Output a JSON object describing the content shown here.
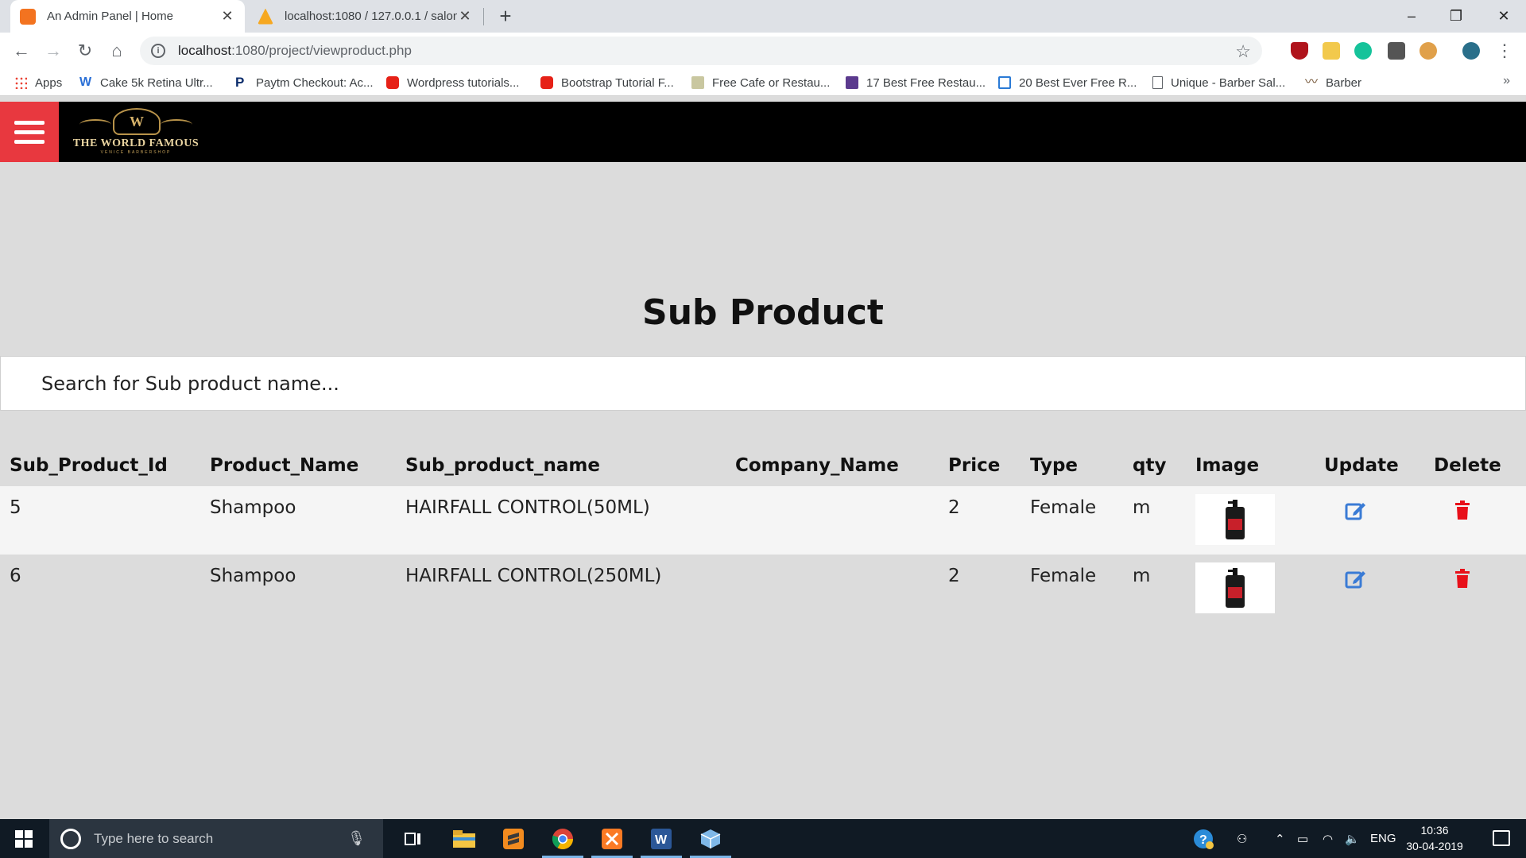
{
  "browser": {
    "tabs": [
      {
        "title": "An Admin Panel | Home",
        "active": true
      },
      {
        "title": "localhost:1080 / 127.0.0.1 / salon",
        "active": false
      }
    ],
    "address": {
      "host": "localhost",
      "path": ":1080/project/viewproduct.php"
    },
    "bookmarks": [
      "Apps",
      "Cake 5k Retina Ultr...",
      "Paytm Checkout: Ac...",
      "Wordpress tutorials...",
      "Bootstrap Tutorial F...",
      "Free Cafe or Restau...",
      "17 Best Free Restau...",
      "20 Best Ever Free R...",
      "Unique - Barber Sal...",
      "Barber"
    ],
    "bookmarks_more": "»"
  },
  "header": {
    "logo_brand": "THE WORLD FAMOUS",
    "logo_sub": "VENICE BARBERSHOP",
    "logo_monogram": "W",
    "colors": {
      "hamburger_bg": "#e8383f",
      "header_bg": "#000000",
      "gold": "#c5a25a"
    }
  },
  "main": {
    "title": "Sub Product",
    "search_placeholder": "Search for Sub product name...",
    "columns": [
      "Sub_Product_Id",
      "Product_Name",
      "Sub_product_name",
      "Company_Name",
      "Price",
      "Type",
      "qty",
      "Image",
      "Update",
      "Delete"
    ],
    "rows": [
      {
        "id": "5",
        "product": "Shampoo",
        "sub_product": "HAIRFALL CONTROL(50ML)",
        "company": "",
        "price": "2",
        "type": "Female",
        "qty": "m"
      },
      {
        "id": "6",
        "product": "Shampoo",
        "sub_product": "HAIRFALL CONTROL(250ML)",
        "company": "",
        "price": "2",
        "type": "Female",
        "qty": "m"
      }
    ],
    "colors": {
      "edit_icon": "#3a7bd5",
      "delete_icon": "#e8101a"
    }
  },
  "taskbar": {
    "search_placeholder": "Type here to search",
    "language": "ENG",
    "time": "10:36",
    "date": "30-04-2019"
  }
}
